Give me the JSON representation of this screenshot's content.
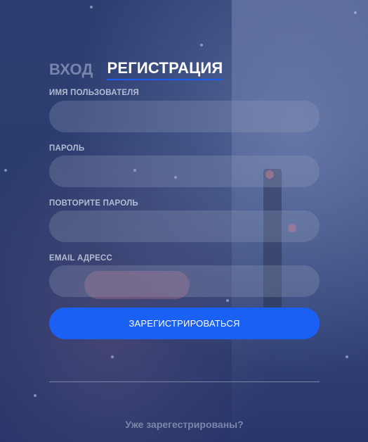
{
  "tabs": {
    "login_label": "ВХОД",
    "register_label": "РЕГИСТРАЦИЯ"
  },
  "fields": [
    {
      "label": "ИМЯ ПОЛЬЗОВАТЕЛЯ",
      "value": "",
      "placeholder": ""
    },
    {
      "label": "ПАРОЛЬ",
      "value": "",
      "placeholder": ""
    },
    {
      "label": "ПОВТОРИТЕ ПАРОЛЬ",
      "value": "",
      "placeholder": ""
    },
    {
      "label": "EMAIL АДРЕСС",
      "value": "",
      "placeholder": ""
    }
  ],
  "submit_label": "ЗАРЕГИСТРИРОВАТЬСЯ",
  "footer_link": "Уже зарегестрированы?",
  "colors": {
    "accent": "#1a60f2",
    "background": "#27386a"
  }
}
